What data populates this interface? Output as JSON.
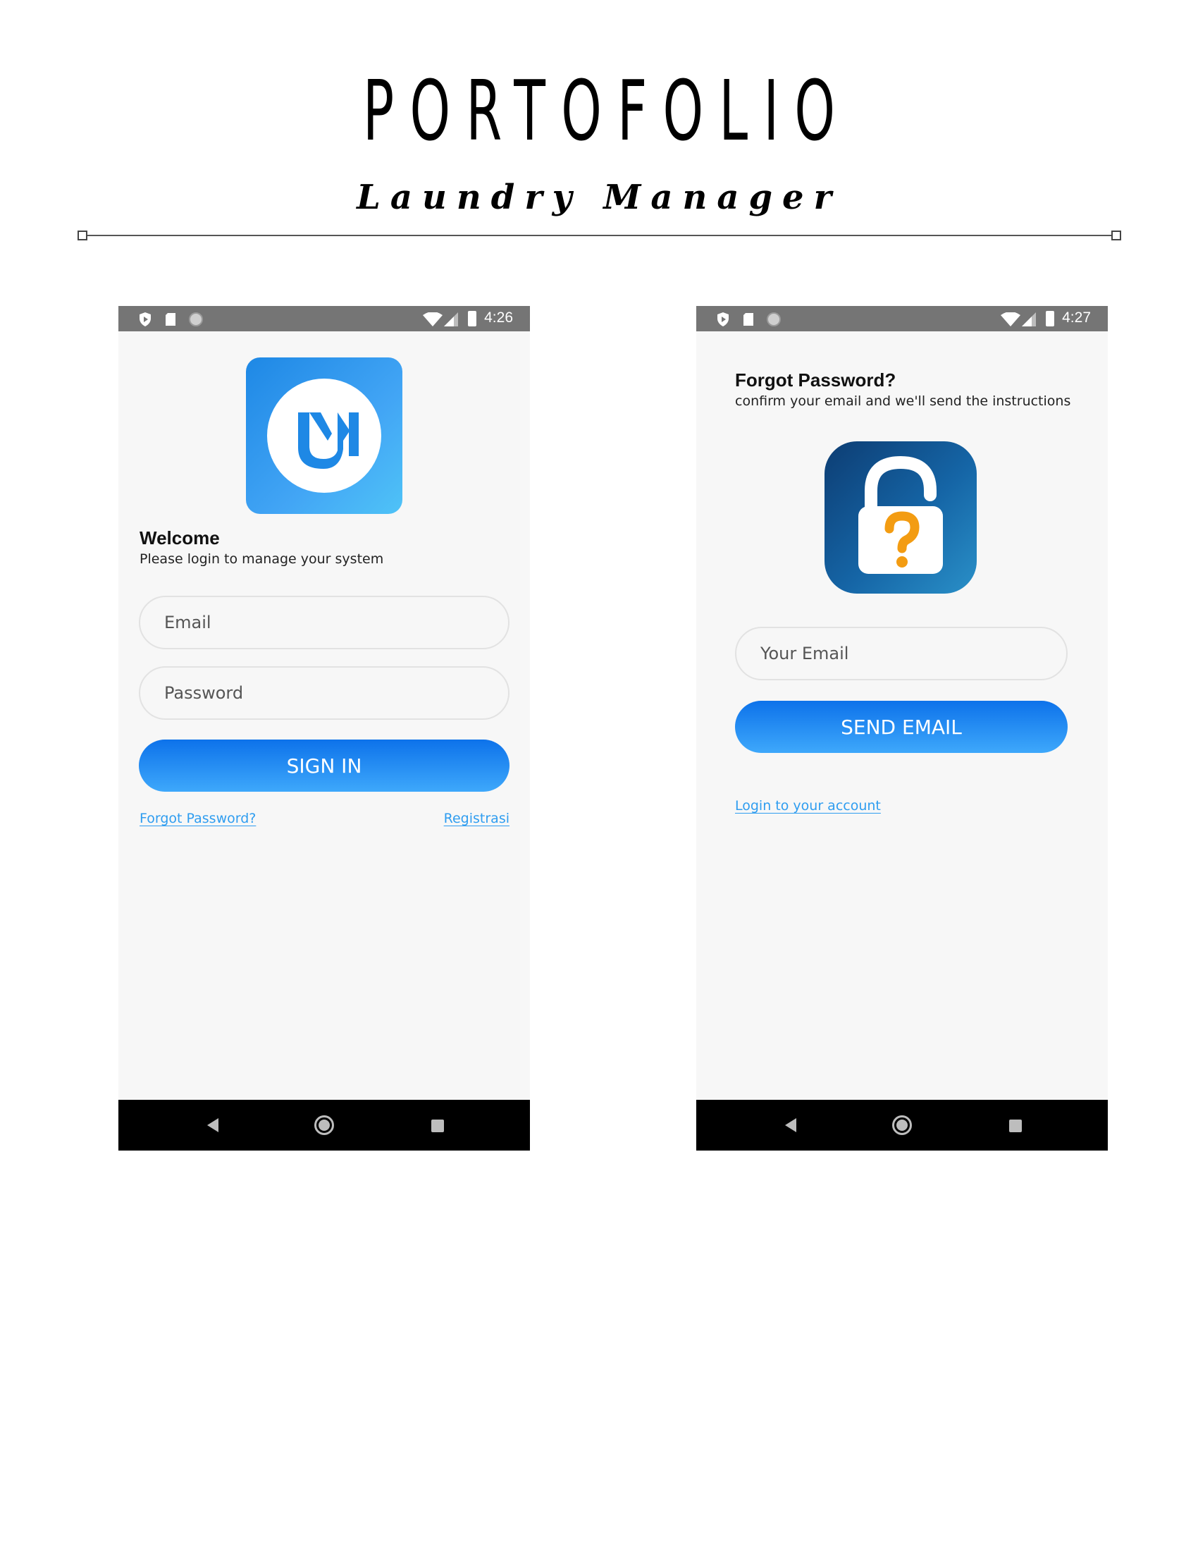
{
  "header": {
    "title": "PORTOFOLIO",
    "subtitle": "Laundry Manager"
  },
  "login_screen": {
    "status_time": "4:26",
    "welcome_title": "Welcome",
    "welcome_subtitle": "Please login to manage your system",
    "email_placeholder": "Email",
    "password_placeholder": "Password",
    "sign_in_label": "SIGN IN",
    "forgot_link": "Forgot Password?",
    "register_link": "Registrasi",
    "logo_icon": "laundry-manager-logo-icon"
  },
  "forgot_screen": {
    "status_time": "4:27",
    "title": "Forgot Password?",
    "subtitle": "confirm your email and we'll send the instructions",
    "email_placeholder": "Your Email",
    "send_label": "SEND EMAIL",
    "login_link": "Login to your account",
    "illustration_icon": "padlock-question-icon"
  },
  "colors": {
    "status_bar": "#757575",
    "nav_bar": "#000000",
    "screen_bg": "#f7f7f7",
    "button_top": "#0d72ea",
    "button_bottom": "#3ea8fb",
    "link": "#2f9df0",
    "lock_question": "#f39c12"
  }
}
